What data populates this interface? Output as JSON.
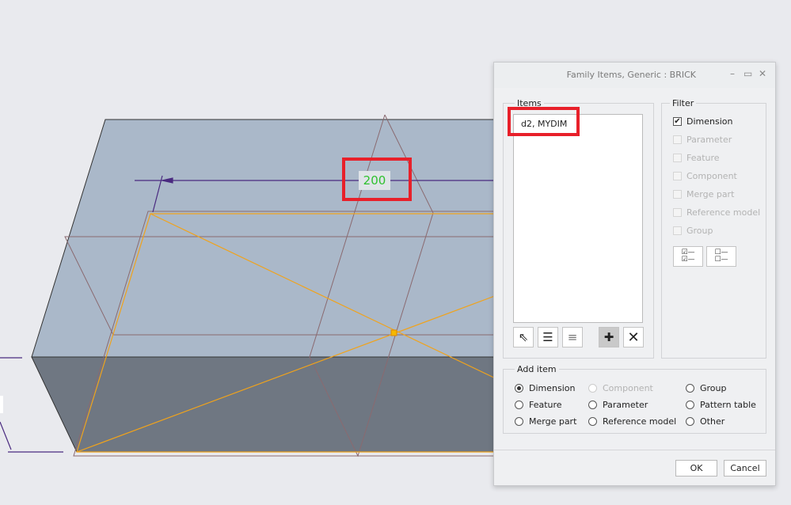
{
  "model": {
    "dimension_value": "200",
    "colors": {
      "top_face": "#aab8c9",
      "front_face": "#6f7782",
      "edge_orange": "#f0a31c",
      "edge_brown": "#8a6a70",
      "dim_line": "#4a2a80",
      "dim_text": "#2fc12f",
      "highlight": "#e8202a"
    }
  },
  "dialog": {
    "title": "Family Items,  Generic : BRICK",
    "items_group": {
      "label": "Items",
      "list": [
        "d2, MYDIM"
      ]
    },
    "filter_group": {
      "label": "Filter",
      "options": [
        {
          "label": "Dimension",
          "checked": true,
          "enabled": true
        },
        {
          "label": "Parameter",
          "checked": false,
          "enabled": false
        },
        {
          "label": "Feature",
          "checked": false,
          "enabled": false
        },
        {
          "label": "Component",
          "checked": false,
          "enabled": false
        },
        {
          "label": "Merge part",
          "checked": false,
          "enabled": false
        },
        {
          "label": "Reference model",
          "checked": false,
          "enabled": false
        },
        {
          "label": "Group",
          "checked": false,
          "enabled": false
        }
      ]
    },
    "add_item_group": {
      "label": "Add item",
      "options": [
        {
          "label": "Dimension",
          "selected": true,
          "enabled": true
        },
        {
          "label": "Component",
          "selected": false,
          "enabled": false
        },
        {
          "label": "Group",
          "selected": false,
          "enabled": true
        },
        {
          "label": "Feature",
          "selected": false,
          "enabled": true
        },
        {
          "label": "Parameter",
          "selected": false,
          "enabled": true
        },
        {
          "label": "Pattern table",
          "selected": false,
          "enabled": true
        },
        {
          "label": "Merge part",
          "selected": false,
          "enabled": true
        },
        {
          "label": "Reference model",
          "selected": false,
          "enabled": true
        },
        {
          "label": "Other",
          "selected": false,
          "enabled": true
        }
      ]
    },
    "ok_label": "OK",
    "cancel_label": "Cancel"
  }
}
